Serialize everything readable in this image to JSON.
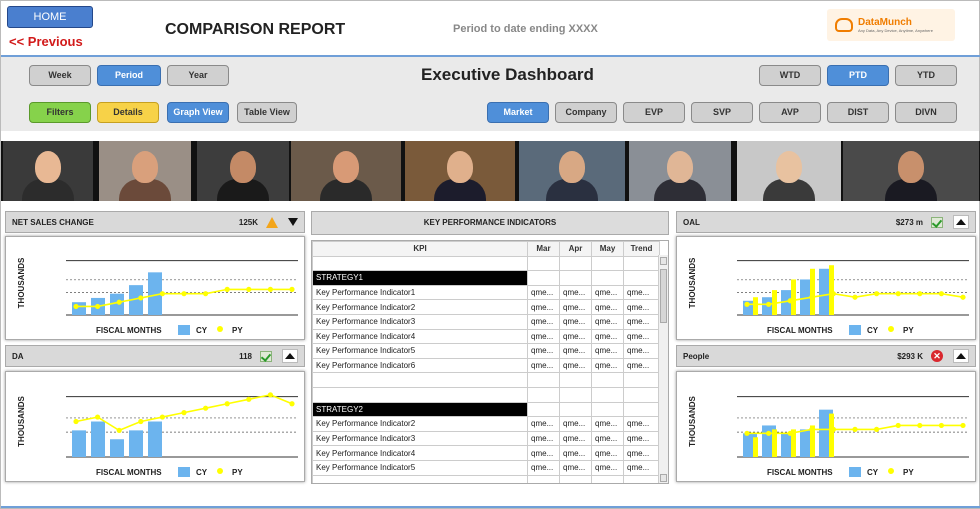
{
  "header": {
    "home_label": "HOME",
    "previous_label": "<< Previous",
    "report_title": "COMPARISON REPORT",
    "period_text": "Period to date ending  XXXX",
    "logo": {
      "name": "DataMunch",
      "tagline": "Any Data, Any Device, Anytime, Anywhere"
    }
  },
  "period_tabs": [
    "Week",
    "Period",
    "Year"
  ],
  "period_active": "Period",
  "dashboard_title": "Executive Dashboard",
  "range_tabs": [
    "WTD",
    "PTD",
    "YTD"
  ],
  "range_active": "PTD",
  "view_buttons": {
    "filters": "Filters",
    "details": "Details",
    "graph_view": "Graph View",
    "table_view": "Table View"
  },
  "level_tabs": [
    "Market",
    "Company",
    "EVP",
    "SVP",
    "AVP",
    "DIST",
    "DIVN"
  ],
  "level_active": "Market",
  "panels": {
    "net_sales": {
      "title": "NET SALES CHANGE",
      "value": "125K",
      "status_icon": "warning-icon",
      "toggle_icon": "caret-down-icon"
    },
    "da": {
      "title": "DA",
      "value": "118",
      "status_icon": "check-icon",
      "toggle_icon": "caret-up-icon"
    },
    "oal": {
      "title": "OAL",
      "value": "$273 m",
      "status_icon": "check-icon",
      "toggle_icon": "caret-up-icon"
    },
    "people": {
      "title": "People",
      "value": "$293 K",
      "status_icon": "error-icon",
      "toggle_icon": "caret-up-icon"
    }
  },
  "chart_common": {
    "ylabel": "THOUSANDS",
    "xlabel": "FISCAL MONTHS",
    "legend": [
      "CY",
      "PY"
    ],
    "colors": {
      "CY": "#6cb4ee",
      "PY": "#ffff00"
    }
  },
  "chart_data": [
    {
      "type": "bar",
      "title": "NET SALES CHANGE",
      "xlabel": "FISCAL MONTHS",
      "ylabel": "THOUSANDS",
      "series": [
        {
          "name": "CY",
          "type": "bar",
          "values": [
            3,
            4,
            5,
            7,
            10
          ]
        },
        {
          "name": "PY",
          "type": "line",
          "values": [
            2,
            2,
            3,
            4,
            5,
            5,
            5,
            6,
            6,
            6,
            6
          ]
        }
      ],
      "ylim": [
        0,
        15
      ],
      "grid": true
    },
    {
      "type": "bar",
      "title": "DA",
      "xlabel": "FISCAL MONTHS",
      "ylabel": "THOUSANDS",
      "series": [
        {
          "name": "CY",
          "type": "bar",
          "values": [
            6,
            8,
            4,
            6,
            8
          ]
        },
        {
          "name": "PY",
          "type": "line",
          "values": [
            8,
            9,
            6,
            8,
            9,
            10,
            11,
            12,
            13,
            14,
            12
          ]
        }
      ],
      "ylim": [
        0,
        16
      ],
      "grid": true
    },
    {
      "type": "bar",
      "title": "OAL",
      "xlabel": "FISCAL MONTHS",
      "ylabel": "THOUSANDS",
      "series": [
        {
          "name": "CY",
          "type": "bar",
          "values": [
            4,
            5,
            7,
            10,
            13
          ]
        },
        {
          "name": "PY",
          "type": "line",
          "values": [
            3,
            3,
            4,
            5,
            6,
            5,
            6,
            6,
            6,
            6,
            5
          ]
        },
        {
          "name": "PY-bars",
          "type": "bar",
          "values": [
            5,
            7,
            10,
            13,
            14
          ]
        }
      ],
      "ylim": [
        0,
        18
      ],
      "grid": true
    },
    {
      "type": "bar",
      "title": "People",
      "xlabel": "FISCAL MONTHS",
      "ylabel": "THOUSANDS",
      "series": [
        {
          "name": "CY",
          "type": "bar",
          "values": [
            6,
            8,
            6,
            7,
            12
          ]
        },
        {
          "name": "PY",
          "type": "line",
          "values": [
            6,
            6,
            6,
            7,
            7,
            7,
            7,
            8,
            8,
            8,
            8
          ]
        },
        {
          "name": "PY-bars",
          "type": "bar",
          "values": [
            5,
            7,
            7,
            8,
            11
          ]
        }
      ],
      "ylim": [
        0,
        18
      ],
      "grid": true
    }
  ],
  "kpi": {
    "title": "KEY PERFORMANCE INDICATORS",
    "columns": [
      "KPI",
      "Mar",
      "Apr",
      "May",
      "Trend"
    ],
    "rows": [
      {
        "kind": "blank"
      },
      {
        "kind": "strategy",
        "label": "STRATEGY1"
      },
      {
        "kind": "kpi",
        "label": "Key Performance Indicator1",
        "vals": [
          "qme...",
          "qme...",
          "qme...",
          "qme..."
        ]
      },
      {
        "kind": "kpi",
        "label": "Key Performance Indicator2",
        "vals": [
          "qme...",
          "qme...",
          "qme...",
          "qme..."
        ]
      },
      {
        "kind": "kpi",
        "label": "Key Performance Indicator3",
        "vals": [
          "qme...",
          "qme...",
          "qme...",
          "qme..."
        ]
      },
      {
        "kind": "kpi",
        "label": "Key Performance Indicator4",
        "vals": [
          "qme...",
          "qme...",
          "qme...",
          "qme..."
        ]
      },
      {
        "kind": "kpi",
        "label": "Key Performance Indicator5",
        "vals": [
          "qme...",
          "qme...",
          "qme...",
          "qme..."
        ]
      },
      {
        "kind": "kpi",
        "label": "Key Performance Indicator6",
        "vals": [
          "qme...",
          "qme...",
          "qme...",
          "qme..."
        ]
      },
      {
        "kind": "blank"
      },
      {
        "kind": "blank"
      },
      {
        "kind": "strategy",
        "label": "STRATEGY2"
      },
      {
        "kind": "kpi",
        "label": "Key Performance Indicator2",
        "vals": [
          "qme...",
          "qme...",
          "qme...",
          "qme..."
        ]
      },
      {
        "kind": "kpi",
        "label": "Key Performance Indicator3",
        "vals": [
          "qme...",
          "qme...",
          "qme...",
          "qme..."
        ]
      },
      {
        "kind": "kpi",
        "label": "Key Performance Indicator4",
        "vals": [
          "qme...",
          "qme...",
          "qme...",
          "qme..."
        ]
      },
      {
        "kind": "kpi",
        "label": "Key Performance Indicator5",
        "vals": [
          "qme...",
          "qme...",
          "qme...",
          "qme..."
        ]
      },
      {
        "kind": "blank"
      }
    ]
  },
  "executives": [
    {
      "name": "executive-photo-1",
      "skin": "#e8b894",
      "suit": "#2c2c2c",
      "bg": "#3a3a3a"
    },
    {
      "name": "executive-photo-2",
      "skin": "#d9a07c",
      "suit": "#6b4a3a",
      "bg": "#9a8f86"
    },
    {
      "name": "executive-photo-3",
      "skin": "#c48a66",
      "suit": "#1a1a1a",
      "bg": "#3d3d3d"
    },
    {
      "name": "executive-photo-4",
      "skin": "#d89a76",
      "suit": "#2a2a2a",
      "bg": "#6b5a4a"
    },
    {
      "name": "executive-photo-5",
      "skin": "#e0b08c",
      "suit": "#1c1c2c",
      "bg": "#7a5a3a"
    },
    {
      "name": "executive-photo-6",
      "skin": "#d8a884",
      "suit": "#2a3040",
      "bg": "#5a6a7a"
    },
    {
      "name": "executive-photo-7",
      "skin": "#e0b696",
      "suit": "#2e2e36",
      "bg": "#8a8f96"
    },
    {
      "name": "executive-photo-8",
      "skin": "#e8c2a0",
      "suit": "#3a3a3a",
      "bg": "#c8c8c8"
    },
    {
      "name": "executive-photo-9",
      "skin": "#c8906c",
      "suit": "#1a1a22",
      "bg": "#4a4a4a"
    }
  ]
}
